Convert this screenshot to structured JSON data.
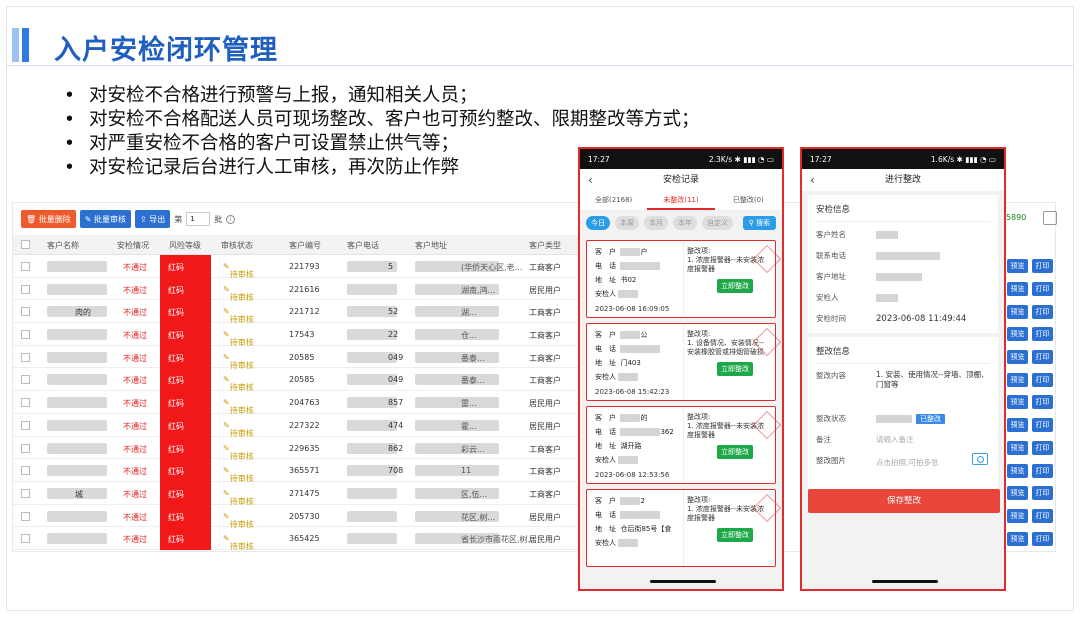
{
  "slide": {
    "title": "入户安检闭环管理",
    "bullets": [
      "对安检不合格进行预警与上报，通知相关人员；",
      "对安检不合格配送人员可现场整改、客户也可预约整改、限期整改等方式；",
      "对严重安检不合格的客户可设置禁止供气等；",
      "对安检记录后台进行人工审核，再次防止作弊"
    ]
  },
  "admin": {
    "toolbar": {
      "batch_delete": "批量删除",
      "batch_review": "批量审核",
      "export": "导出",
      "page_prefix": "第",
      "page_value": "1",
      "page_suffix": "批"
    },
    "badge": "5890",
    "columns": [
      "客户名称",
      "安检情况",
      "风险等级",
      "审核状态",
      "客户编号",
      "客户电话",
      "客户地址",
      "客户类型"
    ],
    "rows": [
      {
        "name": "",
        "result": "不通过",
        "risk": "红码",
        "status": "待审核",
        "id": "221793",
        "phone": "5",
        "addr": "(华侨天心区,老...",
        "type": "工商客户"
      },
      {
        "name": "",
        "result": "不通过",
        "risk": "红码",
        "status": "待审核",
        "id": "221616",
        "phone": "",
        "addr": "湖南,鸿...",
        "type": "居民用户"
      },
      {
        "name": "肉的",
        "result": "不通过",
        "risk": "红码",
        "status": "待审核",
        "id": "221712",
        "phone": "52",
        "addr": "湖...",
        "type": "工商客户"
      },
      {
        "name": "",
        "result": "不通过",
        "risk": "红码",
        "status": "待审核",
        "id": "17543",
        "phone": "22",
        "addr": "仓...",
        "type": "工商客户"
      },
      {
        "name": "",
        "result": "不通过",
        "risk": "红码",
        "status": "待审核",
        "id": "20585",
        "phone": "049",
        "addr": "番泰...",
        "type": "工商客户"
      },
      {
        "name": "",
        "result": "不通过",
        "risk": "红码",
        "status": "待审核",
        "id": "20585",
        "phone": "049",
        "addr": "番泰...",
        "type": "工商客户"
      },
      {
        "name": "",
        "result": "不通过",
        "risk": "红码",
        "status": "待审核",
        "id": "204763",
        "phone": "857",
        "addr": "雷...",
        "type": "居民用户"
      },
      {
        "name": "",
        "result": "不通过",
        "risk": "红码",
        "status": "待审核",
        "id": "227322",
        "phone": "474",
        "addr": "霍...",
        "type": "居民用户"
      },
      {
        "name": "",
        "result": "不通过",
        "risk": "红码",
        "status": "待审核",
        "id": "229635",
        "phone": "862",
        "addr": "彩云...",
        "type": "工商客户"
      },
      {
        "name": "",
        "result": "不通过",
        "risk": "红码",
        "status": "待审核",
        "id": "365571",
        "phone": "708",
        "addr": "11",
        "type": "工商客户"
      },
      {
        "name": "城",
        "result": "不通过",
        "risk": "红码",
        "status": "待审核",
        "id": "271475",
        "phone": "",
        "addr": "区,伍...",
        "type": "工商客户"
      },
      {
        "name": "",
        "result": "不通过",
        "risk": "红码",
        "status": "待审核",
        "id": "205730",
        "phone": "",
        "addr": "花区,树...",
        "type": "居民用户"
      },
      {
        "name": "",
        "result": "不通过",
        "risk": "红码",
        "status": "待审核",
        "id": "365425",
        "phone": "",
        "addr": "省长沙市雨花区,树...",
        "type": "居民用户"
      }
    ],
    "preview_label": "预览",
    "print_label": "打印"
  },
  "phone1": {
    "time": "17:27",
    "net": "2.3K/s",
    "title": "安检记录",
    "tabs": [
      "全部(2168)",
      "未整改(11)",
      "已整改(0)"
    ],
    "filters": [
      "今日",
      "本周",
      "本月",
      "本年",
      "自定义"
    ],
    "search": "搜索",
    "cards": [
      {
        "name": "户",
        "phone": "",
        "addr": "书02",
        "inspector": "",
        "time": "2023-06-08 16:09:05",
        "items": "整改项:\n1. 浓度报警器--未安装浓度报警器"
      },
      {
        "name": "公",
        "phone": "",
        "addr": "门403",
        "inspector": "",
        "time": "2023-06-08 15:42:23",
        "items": "整改项:\n1. 设备情况、安装情况--安装橡胶管或排烟管破损"
      },
      {
        "name": "的",
        "phone": "362",
        "addr": "湖开路",
        "inspector": "",
        "time": "2023-06-08 12:53:56",
        "items": "整改项:\n1. 浓度报警器--未安装浓度报警器"
      },
      {
        "name": "2",
        "phone": "",
        "addr": "仓后街85号【食",
        "inspector": "",
        "time": "",
        "items": "整改项:\n1. 浓度报警器--未安装浓度报警器"
      }
    ],
    "labels": {
      "name": "客　户",
      "phone": "电　话",
      "addr": "地　址",
      "inspector": "安检人",
      "fix": "立即整改"
    }
  },
  "phone2": {
    "time": "17:27",
    "net": "1.6K/s",
    "title": "进行整改",
    "sec1": "安检信息",
    "fields": [
      {
        "k": "客户姓名",
        "v": ""
      },
      {
        "k": "联系电话",
        "v": ""
      },
      {
        "k": "客户地址",
        "v": ""
      },
      {
        "k": "安检人",
        "v": ""
      },
      {
        "k": "安检时间",
        "v": "2023-06-08 11:49:44"
      }
    ],
    "sec2": "整改信息",
    "content_k": "整改内容",
    "content_v": "1. 安装、使用情况--穿墙、顶棚、门窗等",
    "status_k": "整改状态",
    "status_v": "已整改",
    "remark_k": "备注",
    "remark_ph": "请输入备注",
    "photo_k": "整改图片",
    "photo_ph": "点击拍照,可拍多张",
    "save": "保存整改"
  }
}
